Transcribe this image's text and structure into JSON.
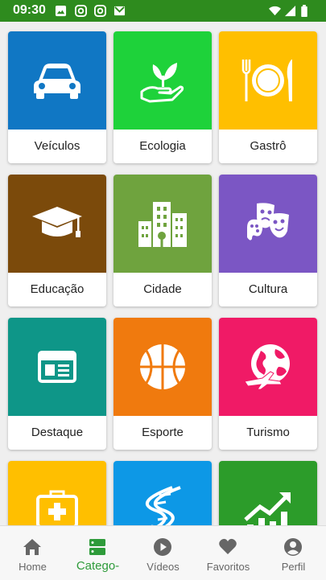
{
  "status_bar": {
    "time": "09:30"
  },
  "categories": [
    {
      "label": "Veículos",
      "icon": "car-icon",
      "color": "#1077c4"
    },
    {
      "label": "Ecologia",
      "icon": "plant-hand-icon",
      "color": "#1ed23a"
    },
    {
      "label": "Gastrô",
      "icon": "plate-cutlery-icon",
      "color": "#ffbf00"
    },
    {
      "label": "Educação",
      "icon": "graduation-cap-icon",
      "color": "#7b4a0b"
    },
    {
      "label": "Cidade",
      "icon": "city-buildings-icon",
      "color": "#6fa33e"
    },
    {
      "label": "Cultura",
      "icon": "theater-masks-icon",
      "color": "#7b56c4"
    },
    {
      "label": "Destaque",
      "icon": "newspaper-icon",
      "color": "#0e9688"
    },
    {
      "label": "Esporte",
      "icon": "basketball-icon",
      "color": "#f07a0e"
    },
    {
      "label": "Turismo",
      "icon": "globe-plane-icon",
      "color": "#f01a66"
    },
    {
      "label": "",
      "icon": "medical-kit-icon",
      "color": "#ffbf00"
    },
    {
      "label": "",
      "icon": "dna-icon",
      "color": "#0d98e6"
    },
    {
      "label": "",
      "icon": "chart-up-icon",
      "color": "#2c9c2a"
    }
  ],
  "bottom_nav": [
    {
      "label": "Home",
      "icon": "home-icon"
    },
    {
      "label": "Catego-",
      "icon": "categories-icon",
      "active": true
    },
    {
      "label": "Vídeos",
      "icon": "play-icon"
    },
    {
      "label": "Favoritos",
      "icon": "heart-icon"
    },
    {
      "label": "Perfil",
      "icon": "profile-icon"
    }
  ],
  "colors": {
    "status_bar": "#2e8b1e",
    "active": "#2e9b3a",
    "inactive": "#666666"
  }
}
